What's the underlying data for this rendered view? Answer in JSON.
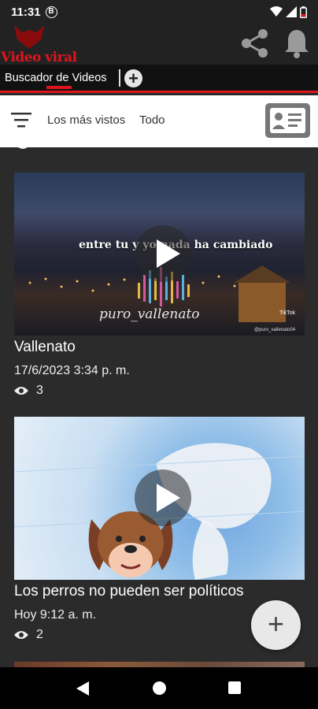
{
  "status_bar": {
    "time": "11:31",
    "badge": "B"
  },
  "app_bar": {
    "logo_text": "Video viral",
    "share_icon": "share-icon",
    "bell_icon": "bell-icon"
  },
  "tabs": {
    "active": "Buscador de Videos",
    "add_icon": "+"
  },
  "filter_bar": {
    "filter_icon": "filter-icon",
    "items": [
      "Los más vistos",
      "Todo"
    ],
    "contact_icon": "contact-card-icon"
  },
  "videos": [
    {
      "title": "Vallenato",
      "date": "17/6/2023 3:34 p. m.",
      "views": "3",
      "overlay_text": "entre tu y yo nada ha cambiado",
      "overlay_signature": "puro_vallenato",
      "tiktok_label": "TikTok",
      "tiktok_user": "@puro_vallenato04"
    },
    {
      "title": "Los perros no pueden ser políticos",
      "date": "Hoy 9:12 a. m.",
      "views": "2"
    }
  ],
  "fab": {
    "label": "+"
  },
  "colors": {
    "accent": "#e0141c",
    "background": "#2b2b2b",
    "bar": "#222222"
  }
}
